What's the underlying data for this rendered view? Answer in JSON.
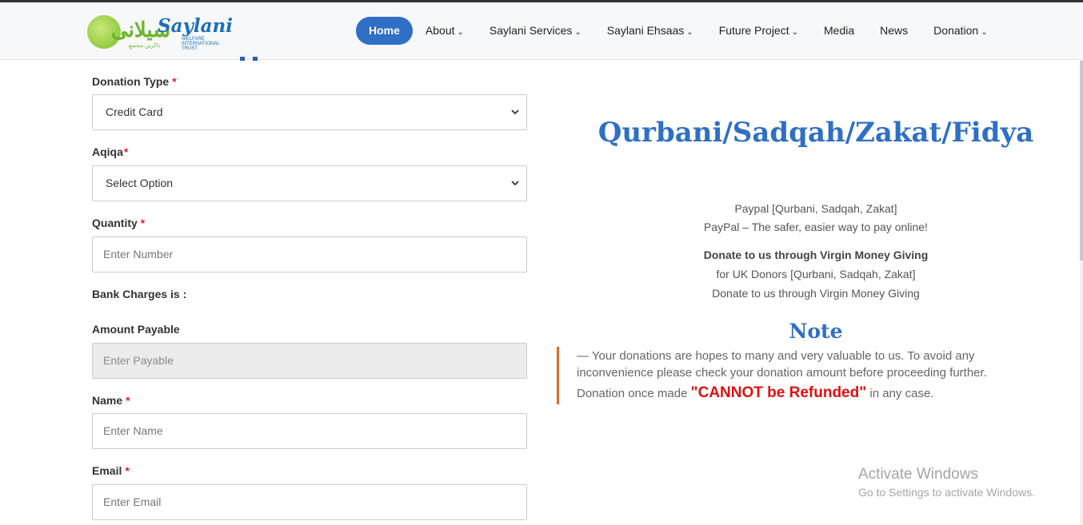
{
  "brand": {
    "logo_text": "Saylani",
    "logo_urdu": "سیلانی",
    "logo_tagline": "WELFARE INTERNATIONAL TRUST",
    "logo_sub": "ذاكرين مجتمع"
  },
  "nav": {
    "items": [
      {
        "label": "Home",
        "active": true,
        "has_dropdown": false
      },
      {
        "label": "About",
        "has_dropdown": true
      },
      {
        "label": "Saylani Services",
        "has_dropdown": true
      },
      {
        "label": "Saylani Ehsaas",
        "has_dropdown": true
      },
      {
        "label": "Future Project",
        "has_dropdown": true
      },
      {
        "label": "Media",
        "has_dropdown": false
      },
      {
        "label": "News",
        "has_dropdown": false
      },
      {
        "label": "Donation",
        "has_dropdown": true
      }
    ],
    "caret_icon": "chevron-down-icon"
  },
  "form": {
    "donation_type": {
      "label": "Donation Type",
      "required": "*",
      "value": "Credit Card"
    },
    "aqiqa": {
      "label": "Aqiqa",
      "required": "*",
      "value": "Select Option"
    },
    "quantity": {
      "label": "Quantity",
      "required": "*",
      "placeholder": "Enter Number"
    },
    "bank_charges": {
      "label": "Bank Charges is :"
    },
    "amount_payable": {
      "label": "Amount Payable",
      "placeholder": "Enter Payable"
    },
    "name": {
      "label": "Name",
      "required": "*",
      "placeholder": "Enter Name"
    },
    "email": {
      "label": "Email",
      "required": "*",
      "placeholder": "Enter Email"
    }
  },
  "right": {
    "title": "Qurbani/Sadqah/Zakat/Fidya",
    "paypal_label": "Paypal [Qurbani, Sadqah, Zakat]",
    "paypal_img_alt": "PayPal – The safer, easier way to pay online!",
    "virgin_heading": "Donate to us through Virgin Money Giving",
    "virgin_sub": "for UK Donors [Qurbani, Sadqah, Zakat]",
    "virgin_img_alt": "Donate to us through Virgin Money Giving",
    "note_title": "Note",
    "note_line1": "— Your donations are hopes to many and very valuable to us. To avoid any",
    "note_line2": "inconvenience please check your donation amount before proceeding further.",
    "note_line3_pre": "Donation once made ",
    "note_refund": "\"CANNOT be Refunded\"",
    "note_line3_post": " in any case."
  },
  "watermark": {
    "line1": "Activate Windows",
    "line2": "Go to Settings to activate Windows."
  },
  "colors": {
    "accent": "#2f6fc6",
    "required": "#e02020",
    "note_border": "#e06a2a",
    "refund": "#e01010"
  }
}
